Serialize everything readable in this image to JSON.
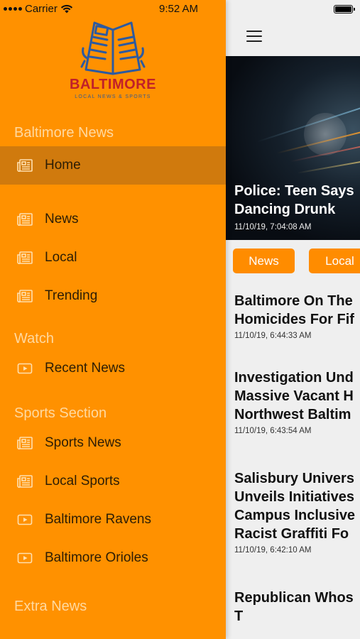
{
  "status_bar": {
    "carrier": "Carrier",
    "time": "9:52 AM"
  },
  "drawer": {
    "logo": {
      "word": "BALTIMORE",
      "tagline": "LOCAL NEWS & SPORTS",
      "icon": "newspaper-reader-icon"
    },
    "sections": [
      {
        "title": "Baltimore News",
        "items": [
          {
            "label": "Home",
            "icon": "newspaper-icon",
            "active": true
          },
          {
            "label": "News",
            "icon": "newspaper-icon"
          },
          {
            "label": "Local",
            "icon": "newspaper-icon"
          },
          {
            "label": "Trending",
            "icon": "newspaper-icon"
          }
        ]
      },
      {
        "title": "Watch",
        "items": [
          {
            "label": "Recent News",
            "icon": "video-icon"
          }
        ]
      },
      {
        "title": "Sports Section",
        "items": [
          {
            "label": "Sports News",
            "icon": "newspaper-icon"
          },
          {
            "label": "Local Sports",
            "icon": "newspaper-icon"
          },
          {
            "label": "Baltimore Ravens",
            "icon": "video-icon"
          },
          {
            "label": "Baltimore Orioles",
            "icon": "video-icon"
          }
        ]
      },
      {
        "title": "Extra News",
        "items": []
      }
    ]
  },
  "main": {
    "hero": {
      "title": "Police: Teen Says\nDancing Drunk",
      "date": "11/10/19, 7:04:08 AM"
    },
    "chips": [
      "News",
      "Local"
    ],
    "articles": [
      {
        "title": "Baltimore On The\nHomicides For Fif",
        "date": "11/10/19, 6:44:33 AM"
      },
      {
        "title": "Investigation Und\nMassive Vacant H\nNorthwest Baltim",
        "date": "11/10/19, 6:43:54 AM"
      },
      {
        "title": "Salisbury Univers\nUnveils Initiatives\nCampus Inclusive\nRacist Graffiti Fo",
        "date": "11/10/19, 6:42:10 AM"
      },
      {
        "title": "Republican Whos\nT",
        "date": ""
      }
    ]
  },
  "colors": {
    "drawer_bg": "#ff9100",
    "active_item_bg": "#d07a0d",
    "section_title": "#ffd9a0",
    "chip_bg": "#ff8c00",
    "logo_red": "#c0202a",
    "logo_blue": "#2d5aa0"
  }
}
